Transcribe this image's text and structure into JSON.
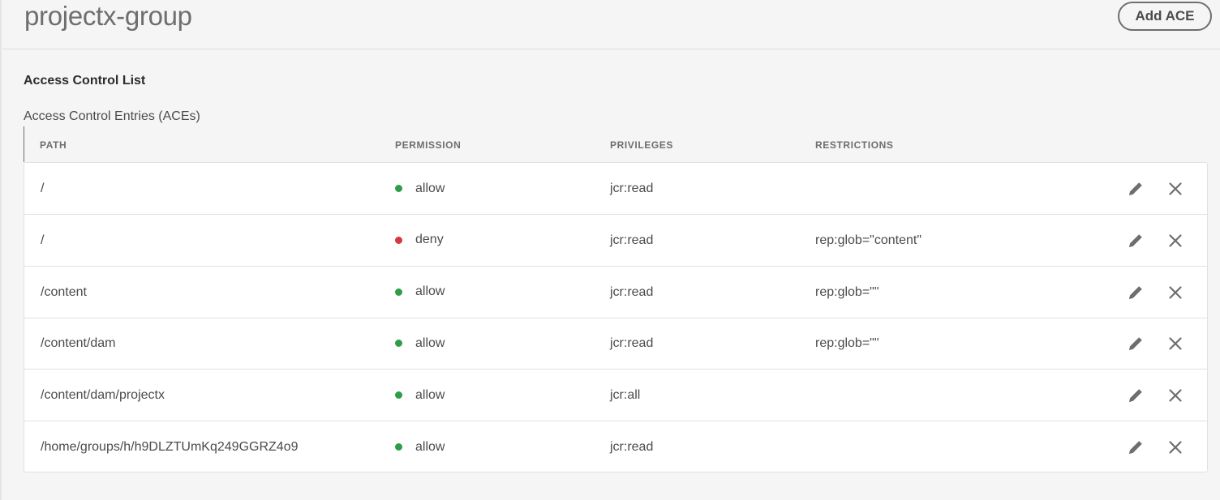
{
  "header": {
    "title": "projectx-group",
    "add_button_label": "Add ACE"
  },
  "section": {
    "title": "Access Control List",
    "subtitle": "Access Control Entries (ACEs)"
  },
  "table": {
    "columns": {
      "path": "PATH",
      "permission": "PERMISSION",
      "privileges": "PRIVILEGES",
      "restrictions": "RESTRICTIONS"
    },
    "rows": [
      {
        "path": "/",
        "permission": "allow",
        "privileges": "jcr:read",
        "restrictions": ""
      },
      {
        "path": "/",
        "permission": "deny",
        "privileges": "jcr:read",
        "restrictions": "rep:glob=\"content\""
      },
      {
        "path": "/content",
        "permission": "allow",
        "privileges": "jcr:read",
        "restrictions": "rep:glob=\"\""
      },
      {
        "path": "/content/dam",
        "permission": "allow",
        "privileges": "jcr:read",
        "restrictions": "rep:glob=\"\""
      },
      {
        "path": "/content/dam/projectx",
        "permission": "allow",
        "privileges": "jcr:all",
        "restrictions": ""
      },
      {
        "path": "/home/groups/h/h9DLZTUmKq249GGRZ4o9",
        "permission": "allow",
        "privileges": "jcr:read",
        "restrictions": ""
      }
    ],
    "row_actions": {
      "edit_icon": "pencil-icon",
      "delete_icon": "close-icon"
    }
  },
  "colors": {
    "allow": "#2d9d48",
    "deny": "#d7373f",
    "icon": "#6e6e6e"
  }
}
